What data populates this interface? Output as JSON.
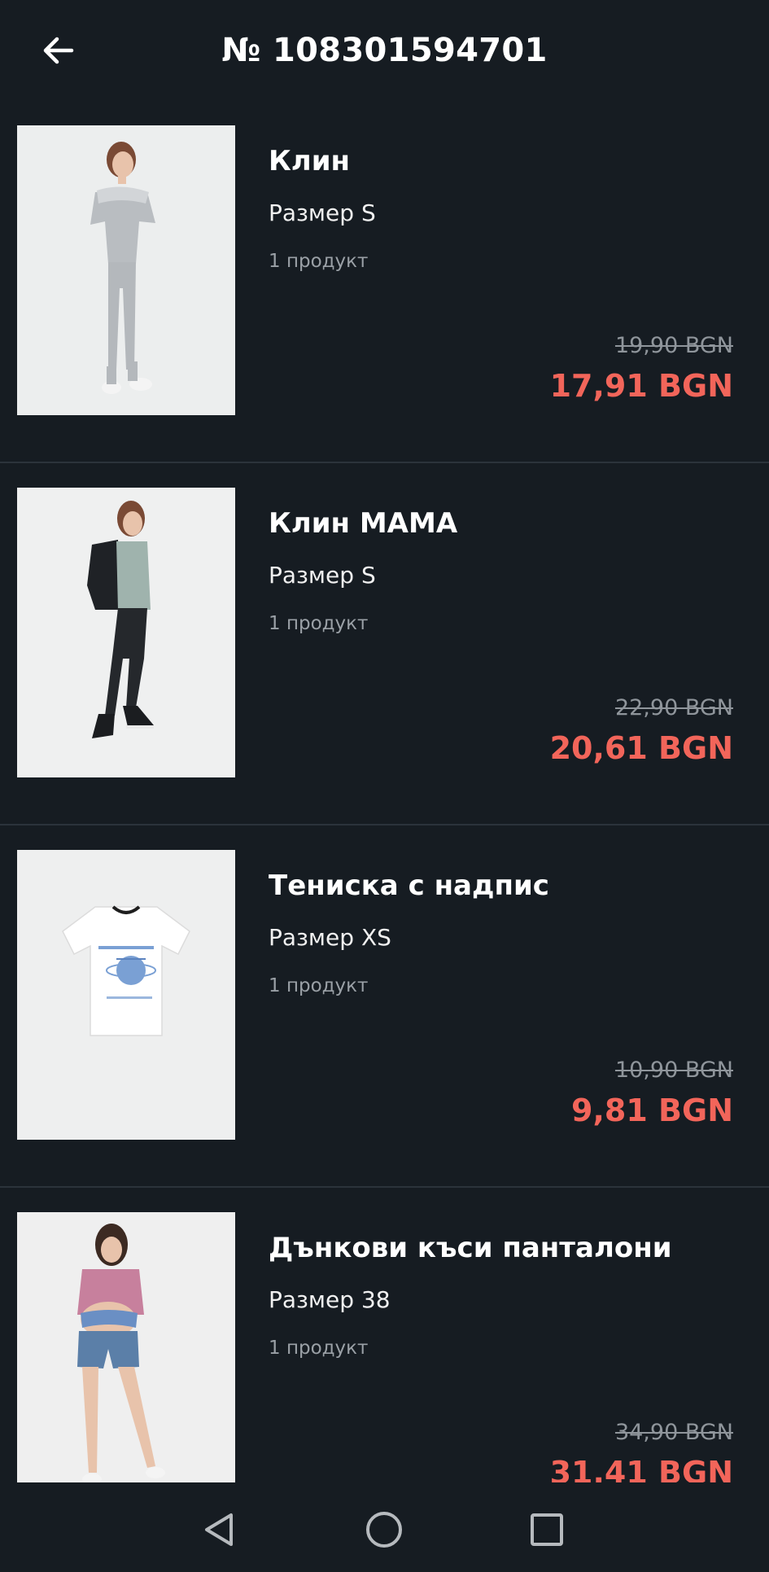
{
  "header": {
    "title": "№ 108301594701",
    "back_icon": "arrow-left-icon"
  },
  "items": [
    {
      "name": "Клин",
      "size": "Размер S",
      "qty": "1 продукт",
      "old_price": "19,90 BGN",
      "new_price": "17,91 BGN"
    },
    {
      "name": "Клин MAMA",
      "size": "Размер S",
      "qty": "1 продукт",
      "old_price": "22,90 BGN",
      "new_price": "20,61 BGN"
    },
    {
      "name": "Тениска с надпис",
      "size": "Размер XS",
      "qty": "1 продукт",
      "old_price": "10,90 BGN",
      "new_price": "9,81 BGN"
    },
    {
      "name": "Дънкови къси панталони",
      "size": "Размер 38",
      "qty": "1 продукт",
      "old_price": "34,90 BGN",
      "new_price": "31,41 BGN"
    }
  ],
  "navbar": {
    "back": "triangle-back-icon",
    "home": "circle-home-icon",
    "recents": "square-recents-icon"
  },
  "colors": {
    "background": "#161c22",
    "sale_price": "#f2655a",
    "old_price": "#8f959b"
  }
}
